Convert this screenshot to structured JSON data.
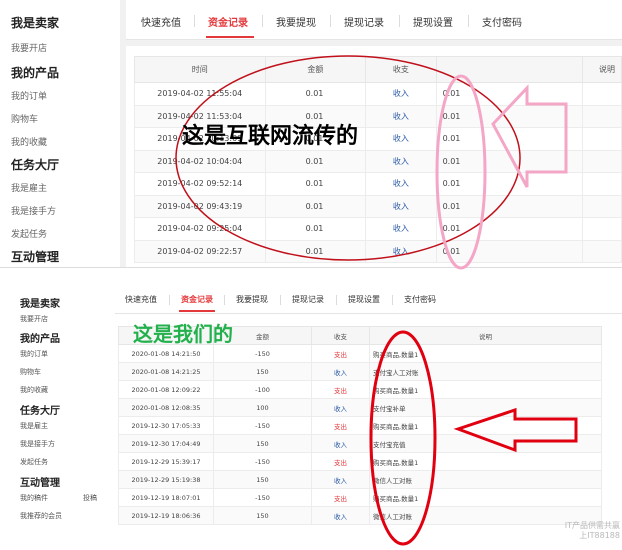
{
  "top": {
    "sidebar": {
      "groups": [
        {
          "title": "我是卖家",
          "items": [
            "我要开店"
          ]
        },
        {
          "title": "我的产品",
          "items": [
            "我的订单",
            "购物车",
            "我的收藏"
          ]
        },
        {
          "title": "任务大厅",
          "items": [
            "我是雇主",
            "我是接手方",
            "发起任务"
          ]
        },
        {
          "title": "互动管理",
          "items": []
        }
      ]
    },
    "tabs": [
      "快速充值",
      "资金记录",
      "我要提现",
      "提现记录",
      "提现设置",
      "支付密码"
    ],
    "active_tab": "资金记录",
    "table": {
      "columns": [
        "时间",
        "金额",
        "收支",
        "",
        "说明"
      ],
      "rows": [
        [
          "2019-04-02 11:55:04",
          "0.01",
          "收入",
          "0.01",
          ""
        ],
        [
          "2019-04-02 11:53:04",
          "0.01",
          "收入",
          "0.01",
          ""
        ],
        [
          "2019-04-02 10:13:09",
          "0.01",
          "收入",
          "0.01",
          ""
        ],
        [
          "2019-04-02 10:04:04",
          "0.01",
          "收入",
          "0.01",
          ""
        ],
        [
          "2019-04-02 09:52:14",
          "0.01",
          "收入",
          "0.01",
          ""
        ],
        [
          "2019-04-02 09:43:19",
          "0.01",
          "收入",
          "0.01",
          ""
        ],
        [
          "2019-04-02 09:25:04",
          "0.01",
          "收入",
          "0.01",
          ""
        ],
        [
          "2019-04-02 09:22:57",
          "0.01",
          "收入",
          "0.01",
          ""
        ]
      ]
    },
    "caption": "这是互联网流传的"
  },
  "bottom": {
    "sidebar": {
      "groups": [
        {
          "title": "我是卖家",
          "items": [
            "我要开店"
          ]
        },
        {
          "title": "我的产品",
          "items": [
            "我的订单",
            "购物车",
            "我的收藏"
          ]
        },
        {
          "title": "任务大厅",
          "items": [
            "我是雇主",
            "我是接手方",
            "发起任务"
          ]
        },
        {
          "title": "互动管理",
          "items": [
            "我的稿件",
            "我推荐的会员"
          ]
        }
      ],
      "extra_label": "投稿"
    },
    "tabs": [
      "快速充值",
      "资金记录",
      "我要提现",
      "提现记录",
      "提现设置",
      "支付密码"
    ],
    "active_tab": "资金记录",
    "table": {
      "columns": [
        "",
        "金额",
        "收支",
        "说明"
      ],
      "rows": [
        [
          "2020-01-08 14:21:50",
          "-150",
          "支出",
          "购买商品,数量1"
        ],
        [
          "2020-01-08 14:21:25",
          "150",
          "收入",
          "支付宝人工对账"
        ],
        [
          "2020-01-08 12:09:22",
          "-100",
          "支出",
          "购买商品,数量1"
        ],
        [
          "2020-01-08 12:08:35",
          "100",
          "收入",
          "支付宝补单"
        ],
        [
          "2019-12-30 17:05:33",
          "-150",
          "支出",
          "购买商品,数量1"
        ],
        [
          "2019-12-30 17:04:49",
          "150",
          "收入",
          "支付宝充值"
        ],
        [
          "2019-12-29 15:39:17",
          "-150",
          "支出",
          "购买商品,数量1"
        ],
        [
          "2019-12-29 15:19:38",
          "150",
          "收入",
          "微信人工对账"
        ],
        [
          "2019-12-19 18:07:01",
          "-150",
          "支出",
          "购买商品,数量1"
        ],
        [
          "2019-12-19 18:06:36",
          "150",
          "收入",
          "微信人工对账"
        ]
      ]
    },
    "caption": "这是我们的"
  },
  "watermark": [
    "IT产品供需共赢",
    "上IT88188"
  ],
  "colors": {
    "accent_red": "#e4393c",
    "income_blue": "#2b5aa6",
    "caption_green": "#22b14c",
    "ellipse_red": "#c0101a",
    "arrow_pink": "#f4a6c6",
    "oval_pink": "#f4a6c6"
  }
}
